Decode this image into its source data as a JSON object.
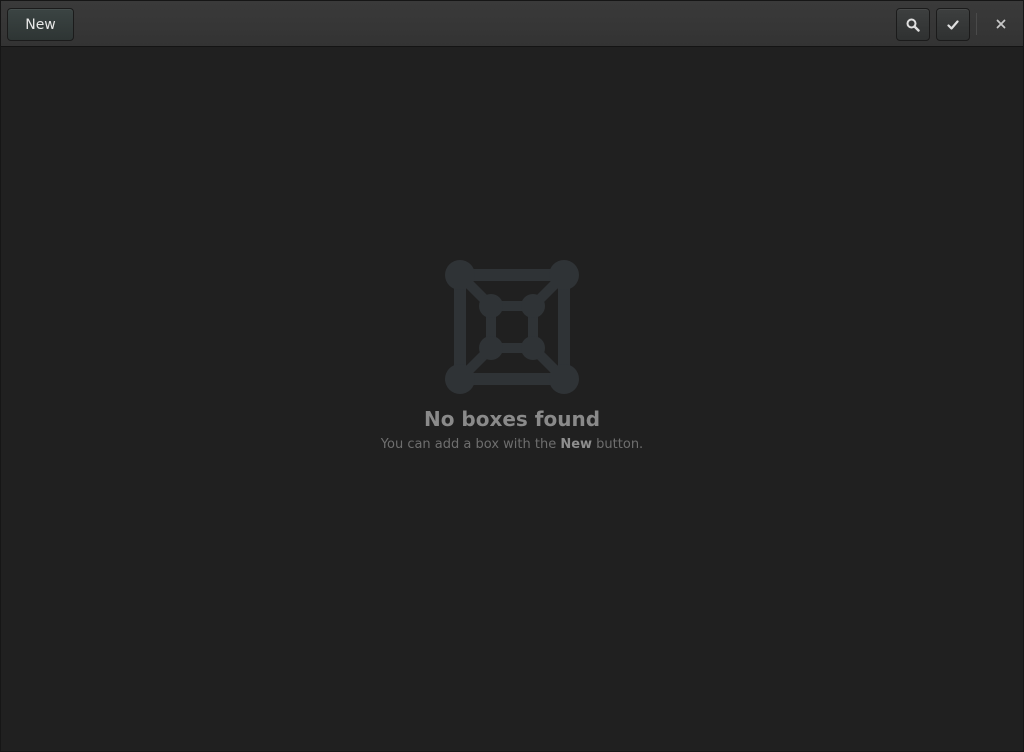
{
  "header": {
    "new_label": "New",
    "search_icon": "search-icon",
    "select_icon": "checkmark-icon",
    "close_icon": "close-icon"
  },
  "empty_state": {
    "icon": "boxes-icon",
    "title": "No boxes found",
    "hint_prefix": "You can add a box with the ",
    "hint_bold": "New",
    "hint_suffix": " button."
  },
  "colors": {
    "background": "#202020",
    "headerbar": "#353535",
    "icon": "#2f3336",
    "title": "#8a8a8a"
  }
}
